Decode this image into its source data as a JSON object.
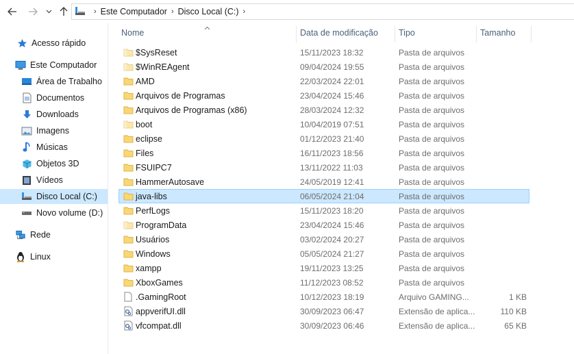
{
  "nav": {
    "back": "back-arrow-icon",
    "forward": "forward-arrow-icon",
    "recent": "chevron-down-icon",
    "up": "up-arrow-icon"
  },
  "breadcrumb": [
    "Este Computador",
    "Disco Local (C:)"
  ],
  "sidebar": {
    "items": [
      {
        "label": "Acesso rápido",
        "icon": "star-icon"
      },
      {
        "label": "Este Computador",
        "icon": "computer-icon"
      },
      {
        "label": "Área de Trabalho",
        "icon": "desktop-icon"
      },
      {
        "label": "Documentos",
        "icon": "document-icon"
      },
      {
        "label": "Downloads",
        "icon": "download-icon"
      },
      {
        "label": "Imagens",
        "icon": "pictures-icon"
      },
      {
        "label": "Músicas",
        "icon": "music-icon"
      },
      {
        "label": "Objetos 3D",
        "icon": "cube-icon"
      },
      {
        "label": "Vídeos",
        "icon": "video-icon"
      },
      {
        "label": "Disco Local (C:)",
        "icon": "drive-icon",
        "selected": true
      },
      {
        "label": "Novo volume (D:)",
        "icon": "drive-icon"
      },
      {
        "label": "Rede",
        "icon": "network-icon"
      },
      {
        "label": "Linux",
        "icon": "penguin-icon"
      }
    ]
  },
  "columns": {
    "name": "Nome",
    "date": "Data de modificação",
    "type": "Tipo",
    "size": "Tamanho"
  },
  "files": [
    {
      "name": "$SysReset",
      "date": "15/11/2023 18:32",
      "type": "Pasta de arquivos",
      "size": "",
      "kind": "folder-faded"
    },
    {
      "name": "$WinREAgent",
      "date": "09/04/2024 19:55",
      "type": "Pasta de arquivos",
      "size": "",
      "kind": "folder-faded"
    },
    {
      "name": "AMD",
      "date": "22/03/2024 22:01",
      "type": "Pasta de arquivos",
      "size": "",
      "kind": "folder"
    },
    {
      "name": "Arquivos de Programas",
      "date": "23/04/2024 15:46",
      "type": "Pasta de arquivos",
      "size": "",
      "kind": "folder"
    },
    {
      "name": "Arquivos de Programas (x86)",
      "date": "28/03/2024 12:32",
      "type": "Pasta de arquivos",
      "size": "",
      "kind": "folder"
    },
    {
      "name": "boot",
      "date": "10/04/2019 07:51",
      "type": "Pasta de arquivos",
      "size": "",
      "kind": "folder-faded"
    },
    {
      "name": "eclipse",
      "date": "01/12/2023 21:40",
      "type": "Pasta de arquivos",
      "size": "",
      "kind": "folder"
    },
    {
      "name": "Files",
      "date": "16/11/2023 18:56",
      "type": "Pasta de arquivos",
      "size": "",
      "kind": "folder"
    },
    {
      "name": "FSUIPC7",
      "date": "13/11/2022 11:03",
      "type": "Pasta de arquivos",
      "size": "",
      "kind": "folder"
    },
    {
      "name": "HammerAutosave",
      "date": "24/05/2019 12:41",
      "type": "Pasta de arquivos",
      "size": "",
      "kind": "folder"
    },
    {
      "name": "java-libs",
      "date": "06/05/2024 21:04",
      "type": "Pasta de arquivos",
      "size": "",
      "kind": "folder",
      "selected": true
    },
    {
      "name": "PerfLogs",
      "date": "15/11/2023 18:20",
      "type": "Pasta de arquivos",
      "size": "",
      "kind": "folder"
    },
    {
      "name": "ProgramData",
      "date": "23/04/2024 15:46",
      "type": "Pasta de arquivos",
      "size": "",
      "kind": "folder-faded"
    },
    {
      "name": "Usuários",
      "date": "03/02/2024 20:27",
      "type": "Pasta de arquivos",
      "size": "",
      "kind": "folder"
    },
    {
      "name": "Windows",
      "date": "05/05/2024 21:27",
      "type": "Pasta de arquivos",
      "size": "",
      "kind": "folder"
    },
    {
      "name": "xampp",
      "date": "19/11/2023 13:25",
      "type": "Pasta de arquivos",
      "size": "",
      "kind": "folder"
    },
    {
      "name": "XboxGames",
      "date": "11/12/2023 08:52",
      "type": "Pasta de arquivos",
      "size": "",
      "kind": "folder"
    },
    {
      "name": ".GamingRoot",
      "date": "10/12/2023 18:19",
      "type": "Arquivo GAMING...",
      "size": "1 KB",
      "kind": "file"
    },
    {
      "name": "appverifUI.dll",
      "date": "30/09/2023 06:47",
      "type": "Extensão de aplica...",
      "size": "110 KB",
      "kind": "dll"
    },
    {
      "name": "vfcompat.dll",
      "date": "30/09/2023 06:46",
      "type": "Extensão de aplica...",
      "size": "65 KB",
      "kind": "dll"
    }
  ],
  "colors": {
    "selection": "#cce8ff",
    "selectionBorder": "#99d1ff",
    "folder": "#f8d775",
    "header": "#4c607a"
  }
}
